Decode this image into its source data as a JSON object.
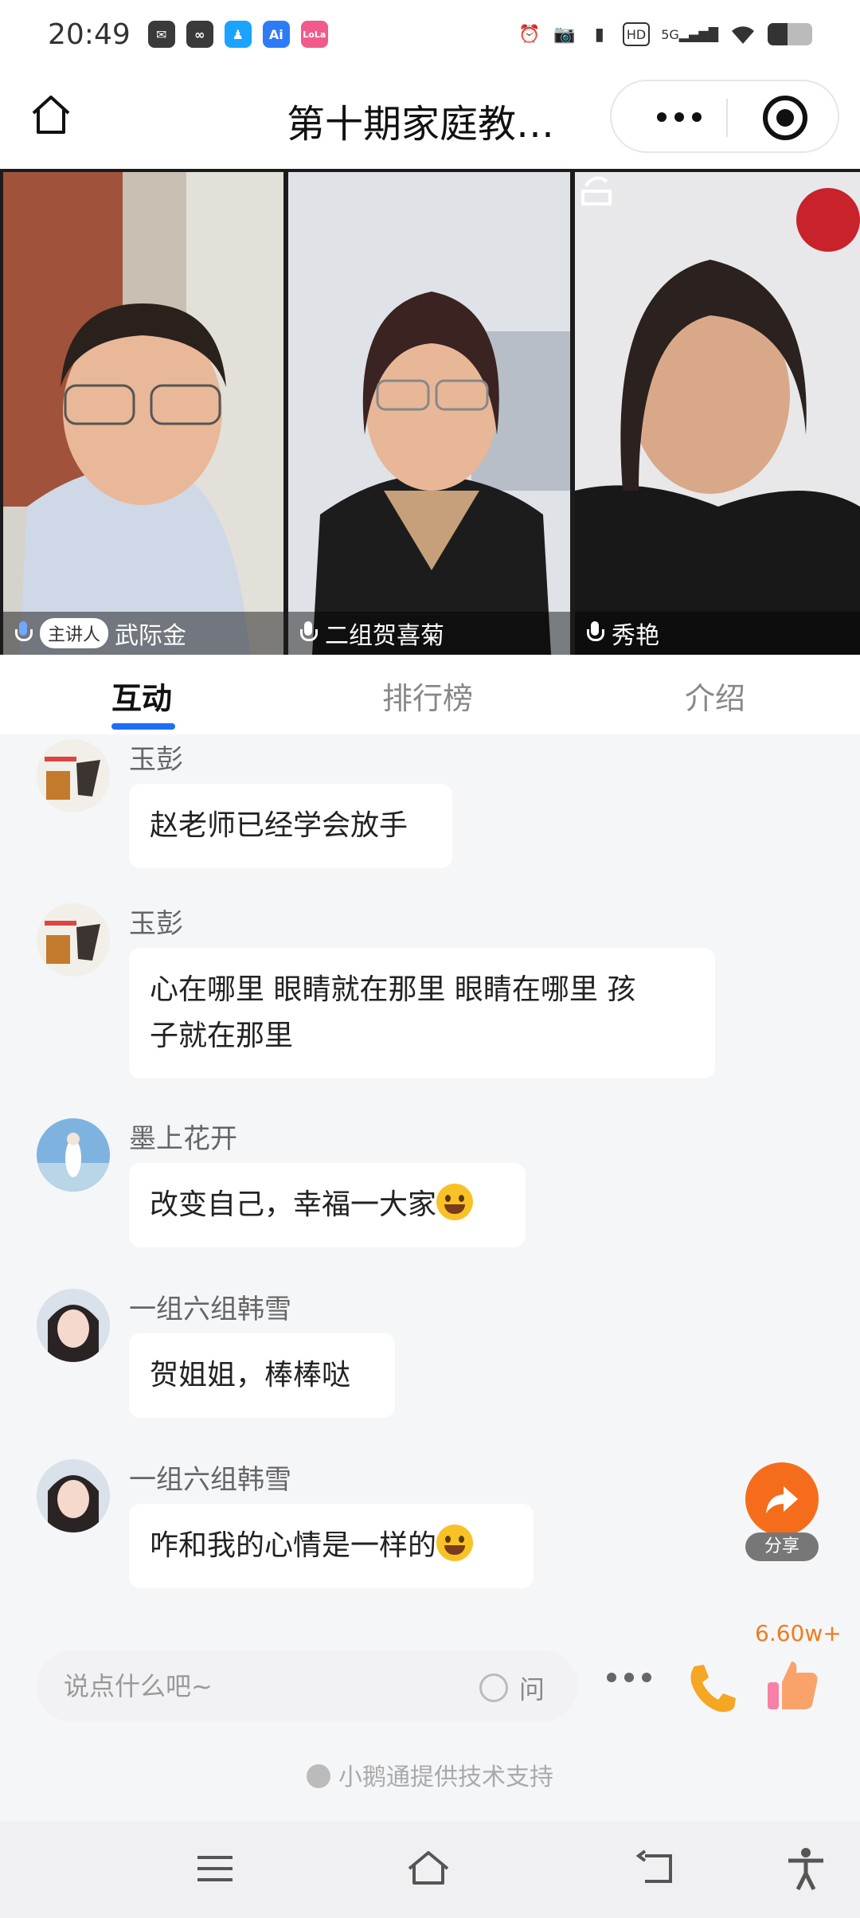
{
  "status_bar": {
    "time": "20:49",
    "app_icons": [
      {
        "name": "message-app-icon",
        "glyph": "✉",
        "color": "#3a3a3a"
      },
      {
        "name": "link-app-icon",
        "glyph": "∞",
        "color": "#3a3a3a"
      },
      {
        "name": "qq-app-icon",
        "glyph": "♟",
        "color": "#1aa3ff"
      },
      {
        "name": "ai-app-icon",
        "glyph": "Ai",
        "color": "#2d7cf6"
      },
      {
        "name": "lola-app-icon",
        "glyph": "LoLa",
        "color": "#f05b8c"
      }
    ],
    "network_label": "HD",
    "signal_label": "5G",
    "battery_level": 0.45
  },
  "header": {
    "title": "第十期家庭教…"
  },
  "videos": [
    {
      "name": "武际金",
      "tag": "主讲人",
      "mic_active": true
    },
    {
      "name": "二组贺喜菊",
      "tag": "",
      "mic_active": false
    },
    {
      "name": "秀艳",
      "tag": "",
      "mic_active": false
    }
  ],
  "tabs": [
    {
      "label": "互动",
      "active": true
    },
    {
      "label": "排行榜",
      "active": false
    },
    {
      "label": "介绍",
      "active": false
    }
  ],
  "messages": [
    {
      "sender": "玉彭",
      "text": "赵老师已经学会放手",
      "emoji": false
    },
    {
      "sender": "玉彭",
      "text_lines": [
        "心在哪里 眼睛就在那里 眼睛在哪里 孩",
        "子就在那里"
      ],
      "emoji": false
    },
    {
      "sender": "墨上花开",
      "text": "改变自己，幸福一大家",
      "emoji": true
    },
    {
      "sender": "一组六组韩雪",
      "text": "贺姐姐，棒棒哒",
      "emoji": false
    },
    {
      "sender": "一组六组韩雪",
      "text": "咋和我的心情是一样的",
      "emoji": true
    }
  ],
  "share": {
    "label": "分享"
  },
  "input": {
    "placeholder": "说点什么吧~",
    "ask_label": "问",
    "like_count": "6.60w+"
  },
  "footer": {
    "powered_by": "小鹅通提供技术支持"
  },
  "colors": {
    "accent": "#1e6ef5",
    "share": "#f56d1b",
    "like_count": "#f07c1e"
  }
}
